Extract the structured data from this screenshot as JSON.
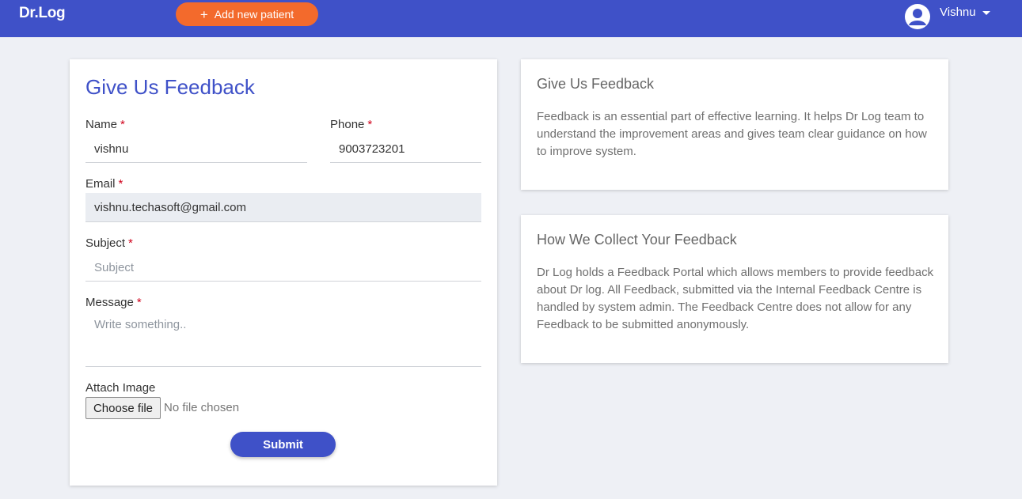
{
  "header": {
    "brand": "Dr.Log",
    "add_patient_label": "Add new patient",
    "user_name": "Vishnu",
    "background": "#3f51c8",
    "accent": "#f36a2c"
  },
  "form": {
    "title": "Give Us Feedback",
    "name": {
      "label": "Name",
      "required_mark": "*",
      "value": "vishnu"
    },
    "phone": {
      "label": "Phone",
      "required_mark": "*",
      "value": "9003723201"
    },
    "email": {
      "label": "Email",
      "required_mark": "*",
      "value": "vishnu.techasoft@gmail.com"
    },
    "subject": {
      "label": "Subject",
      "required_mark": "*",
      "value": "",
      "placeholder": "Subject"
    },
    "message": {
      "label": "Message",
      "required_mark": "*",
      "value": "",
      "placeholder": "Write something.."
    },
    "attach": {
      "label": "Attach Image",
      "button_label": "Choose file",
      "status": "No file chosen"
    },
    "submit_label": "Submit"
  },
  "info": [
    {
      "title": "Give Us Feedback",
      "text": "Feedback is an essential part of effective learning. It helps Dr Log team to understand the improvement areas and gives team clear guidance on how to improve system."
    },
    {
      "title": "How We Collect Your Feedback",
      "text": "Dr Log holds a Feedback Portal which allows members to provide feedback about Dr log. All Feedback, submitted via the Internal Feedback Centre is handled by system admin. The Feedback Centre does not allow for any Feedback to be submitted anonymously."
    }
  ],
  "icons": {
    "add": "plus-icon",
    "user": "user-avatar-icon",
    "menu": "caret-down-icon"
  }
}
